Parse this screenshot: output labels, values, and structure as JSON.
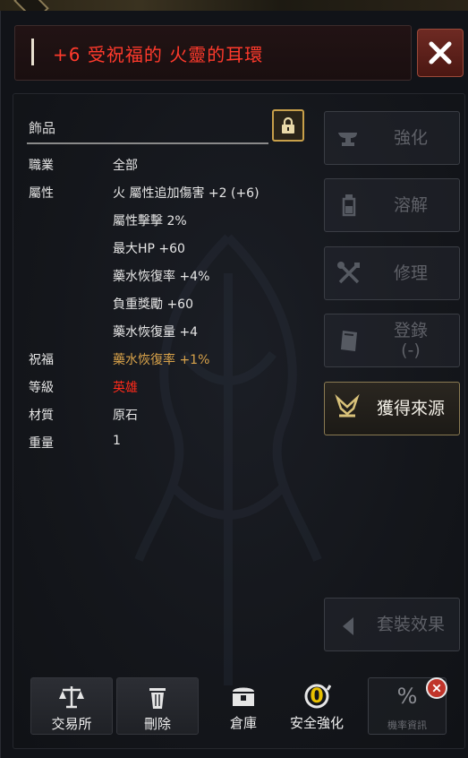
{
  "title": "+6 受祝福的 火靈的耳環",
  "category": "飾品",
  "attributes": [
    {
      "label": "職業",
      "value": "全部",
      "style": "normal"
    },
    {
      "label": "屬性",
      "value": "火 屬性追加傷害 +2 (+6)",
      "style": "normal"
    },
    {
      "label": "",
      "value": "屬性擊擊 2%",
      "style": "normal"
    },
    {
      "label": "",
      "value": "最大HP +60",
      "style": "normal"
    },
    {
      "label": "",
      "value": "藥水恢復率 +4%",
      "style": "normal"
    },
    {
      "label": "",
      "value": "負重獎勵 +60",
      "style": "normal"
    },
    {
      "label": "",
      "value": "藥水恢復量 +4",
      "style": "normal"
    },
    {
      "label": "祝福",
      "value": "藥水恢復率 +1%",
      "style": "gold"
    },
    {
      "label": "等級",
      "value": "英雄",
      "style": "red"
    },
    {
      "label": "材質",
      "value": "原石",
      "style": "normal"
    },
    {
      "label": "重量",
      "value": "1",
      "style": "normal"
    }
  ],
  "side_buttons": {
    "enhance": "強化",
    "dissolve": "溶解",
    "repair": "修理",
    "register": "登錄",
    "register_sub": "(-)",
    "acquire": "獲得來源",
    "set_effect": "套裝效果"
  },
  "bottom_buttons": {
    "exchange": "交易所",
    "delete": "刪除",
    "warehouse": "倉庫",
    "safe_enhance": "安全強化",
    "safe_enhance_count": "0",
    "probability_symbol": "%",
    "probability": "機率資訊"
  },
  "colors": {
    "title": "#ff3a2c",
    "gold": "#d8a24a",
    "rarity": "#ff2a1a",
    "accent_border": "#c8a04a"
  }
}
